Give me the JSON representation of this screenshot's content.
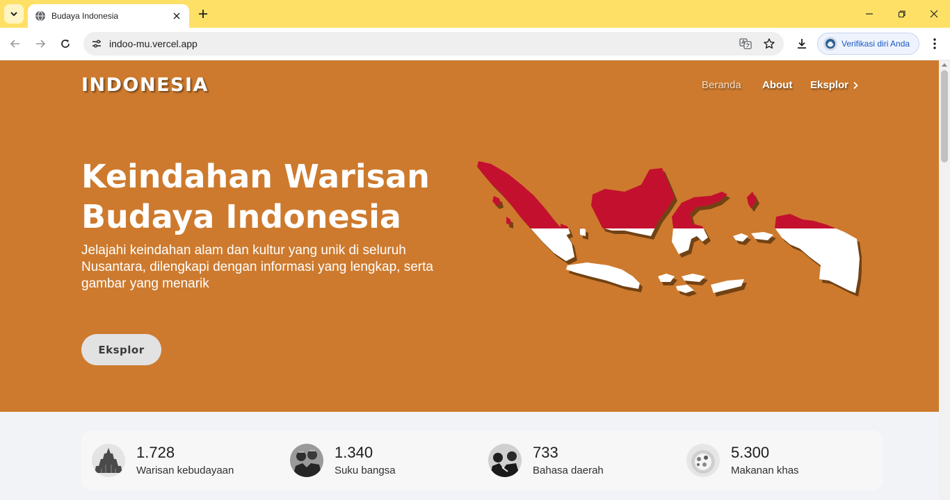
{
  "browser": {
    "tab_title": "Budaya Indonesia",
    "url": "indoo-mu.vercel.app",
    "profile_label": "Verifikasi diri Anda",
    "accent_color": "#ffe066"
  },
  "page": {
    "logo": "INDONESIA",
    "nav": {
      "items": [
        {
          "label": "Beranda"
        },
        {
          "label": "About"
        },
        {
          "label": "Eksplor"
        }
      ]
    },
    "hero": {
      "headline": "Keindahan Warisan Budaya Indonesia",
      "subtext": "Jelajahi keindahan alam dan kultur yang unik di seluruh Nusantara, dilengkapi dengan informasi yang lengkap, serta gambar yang menarik",
      "cta_label": "Eksplor",
      "bg_color": "#cd7a2e",
      "map_colors": {
        "red": "#c4102f",
        "white": "#ffffff"
      }
    },
    "stats": [
      {
        "value": "1.728",
        "label": "Warisan kebudayaan",
        "icon": "temple-photo"
      },
      {
        "value": "1.340",
        "label": "Suku bangsa",
        "icon": "tribe-photo"
      },
      {
        "value": "733",
        "label": "Bahasa daerah",
        "icon": "people-photo"
      },
      {
        "value": "5.300",
        "label": "Makanan khas",
        "icon": "food-photo"
      }
    ]
  }
}
